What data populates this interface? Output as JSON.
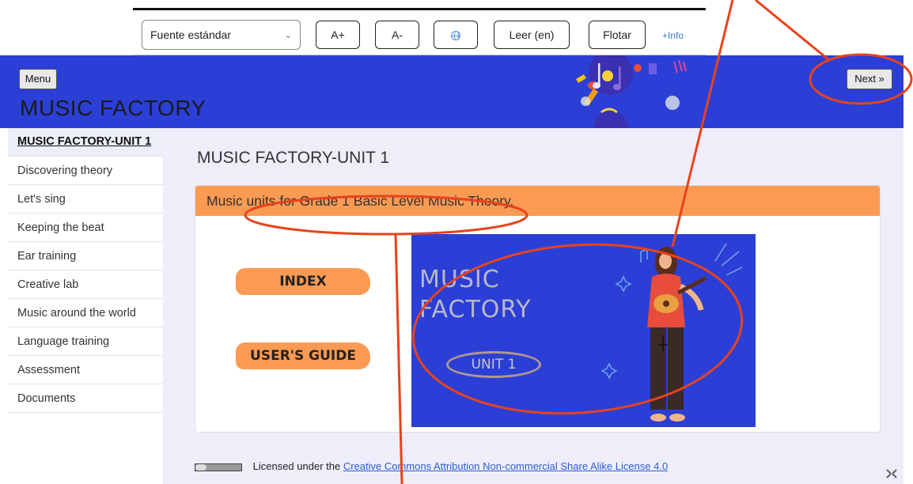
{
  "toolbar": {
    "font_select": "Fuente estándar",
    "increase_font": "A+",
    "decrease_font": "A-",
    "read_button": "Leer (en)",
    "float_button": "Flotar",
    "info_link": "+Info"
  },
  "header": {
    "menu_button": "Menu",
    "site_title": "MUSIC FACTORY",
    "next_button": "Next »"
  },
  "sidebar": {
    "items": [
      {
        "label": "MUSIC FACTORY-UNIT 1",
        "active": true
      },
      {
        "label": "Discovering theory"
      },
      {
        "label": "Let's sing"
      },
      {
        "label": "Keeping the beat"
      },
      {
        "label": "Ear training"
      },
      {
        "label": "Creative lab"
      },
      {
        "label": "Music around the world"
      },
      {
        "label": "Language training"
      },
      {
        "label": "Assessment"
      },
      {
        "label": "Documents"
      }
    ]
  },
  "main": {
    "page_heading": "MUSIC FACTORY-UNIT 1",
    "panel_heading": "Music units for Grade 1 Basic Level Music Theory.",
    "index_button": "INDEX",
    "users_guide_button": "USER'S GUIDE",
    "cover": {
      "line1": "MUSIC",
      "line2": "FACTORY",
      "unit_label": "UNIT 1"
    }
  },
  "footer": {
    "license_prefix": "Licensed under the",
    "license_link": "Creative Commons Attribution Non-commercial Share Alike License 4.0"
  },
  "colors": {
    "header_blue": "#2b3fd6",
    "orange_accent": "#fb9a52",
    "annotation_red": "#e8431c",
    "main_background": "#f0edfa"
  }
}
